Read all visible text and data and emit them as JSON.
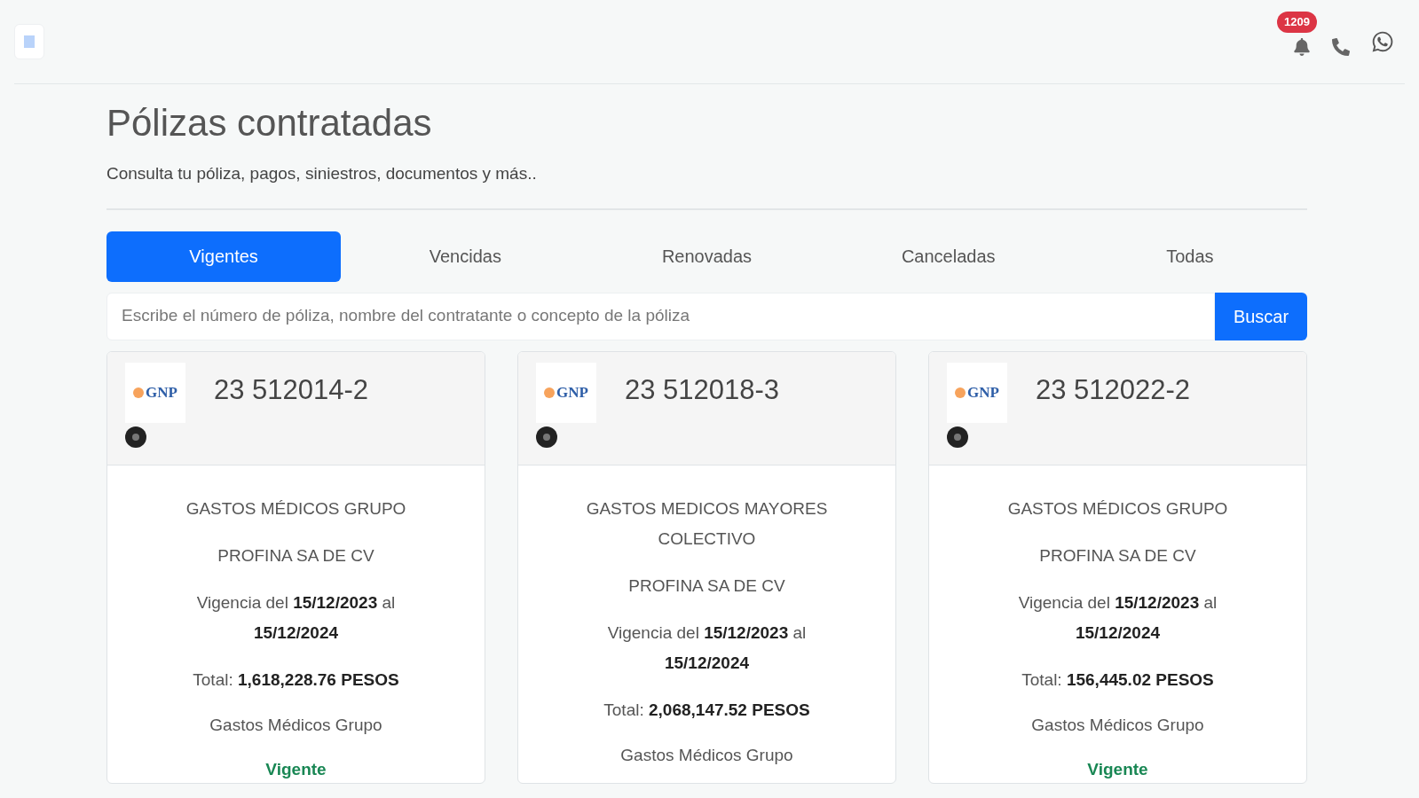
{
  "header": {
    "notification_count": "1209"
  },
  "page": {
    "title": "Pólizas contratadas",
    "subtitle": "Consulta tu póliza, pagos, siniestros, documentos y más.."
  },
  "tabs": [
    {
      "label": "Vigentes",
      "selected": true
    },
    {
      "label": "Vencidas",
      "selected": false
    },
    {
      "label": "Renovadas",
      "selected": false
    },
    {
      "label": "Canceladas",
      "selected": false
    },
    {
      "label": "Todas",
      "selected": false
    }
  ],
  "search": {
    "placeholder": "Escribe el número de póliza, nombre del contratante o concepto de la póliza",
    "button": "Buscar"
  },
  "policies": [
    {
      "logo": "GNP",
      "number": "23 512014-2",
      "product": "GASTOS MÉDICOS GRUPO",
      "holder": "PROFINA SA DE CV",
      "validity": "Vigencia del **15/12/2023** al **15/12/2024**",
      "total": "Total: **1,618,228.76 PESOS**",
      "category": "Gastos Médicos Grupo",
      "status": "Vigente"
    },
    {
      "logo": "GNP",
      "number": "23 512018-3",
      "product": "GASTOS MEDICOS MAYORES COLECTIVO",
      "holder": "PROFINA SA DE CV",
      "validity": "Vigencia del **15/12/2023** al **15/12/2024**",
      "total": "Total: **2,068,147.52 PESOS**",
      "category": "Gastos Médicos Grupo"
    },
    {
      "logo": "GNP",
      "number": "23 512022-2",
      "product": "GASTOS MÉDICOS GRUPO",
      "holder": "PROFINA SA DE CV",
      "validity": "Vigencia del **15/12/2023** al **15/12/2024**",
      "total": "Total: **156,445.02 PESOS**",
      "category": "Gastos Médicos Grupo",
      "status": "Vigente"
    }
  ]
}
